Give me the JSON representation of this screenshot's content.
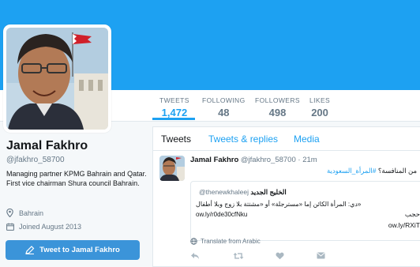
{
  "colors": {
    "accent": "#1da1f2",
    "button": "#3b94d9",
    "muted": "#657786",
    "text": "#14171a"
  },
  "profile": {
    "name": "Jamal Fakhro",
    "handle": "@jfakhro_58700",
    "bio": "Managing partner KPMG Bahrain and Qatar. First vice chairman Shura council Bahrain.",
    "location": "Bahrain",
    "joined": "Joined August 2013",
    "tweet_button": "Tweet to Jamal Fakhro"
  },
  "stats": [
    {
      "label": "TWEETS",
      "value": "1,472",
      "active": true
    },
    {
      "label": "FOLLOWING",
      "value": "48",
      "active": false
    },
    {
      "label": "FOLLOWERS",
      "value": "498",
      "active": false
    },
    {
      "label": "LIKES",
      "value": "200",
      "active": false
    }
  ],
  "tabs": [
    {
      "label": "Tweets",
      "active": true
    },
    {
      "label": "Tweets & replies",
      "active": false
    },
    {
      "label": "Media",
      "active": false
    }
  ],
  "tweet": {
    "author": "Jamal Fakhro",
    "handle": "@jfakhro_58700",
    "time": "· 21m",
    "text_prefix": "من المنافسة؟",
    "hashtag": "#المرأة_السعودية",
    "quote": {
      "author": "الخليج الجديد",
      "handle": "@thenewkhaleej",
      "line1": "دي: المرأة الكائن إما «مسترجلة» أو «مشتتة بلا زوج وبلا أطفال»",
      "link1": "ow.ly/r0de30cfNku",
      "prefix2": "حجب",
      "link2": "ow.ly/RXiT"
    },
    "translate": "Translate from Arabic"
  },
  "icons": {
    "location": "map-pin-icon",
    "calendar": "calendar-icon",
    "compose": "compose-icon",
    "globe": "globe-icon",
    "reply": "reply-icon",
    "retweet": "retweet-icon",
    "like": "heart-icon",
    "dm": "envelope-icon"
  }
}
